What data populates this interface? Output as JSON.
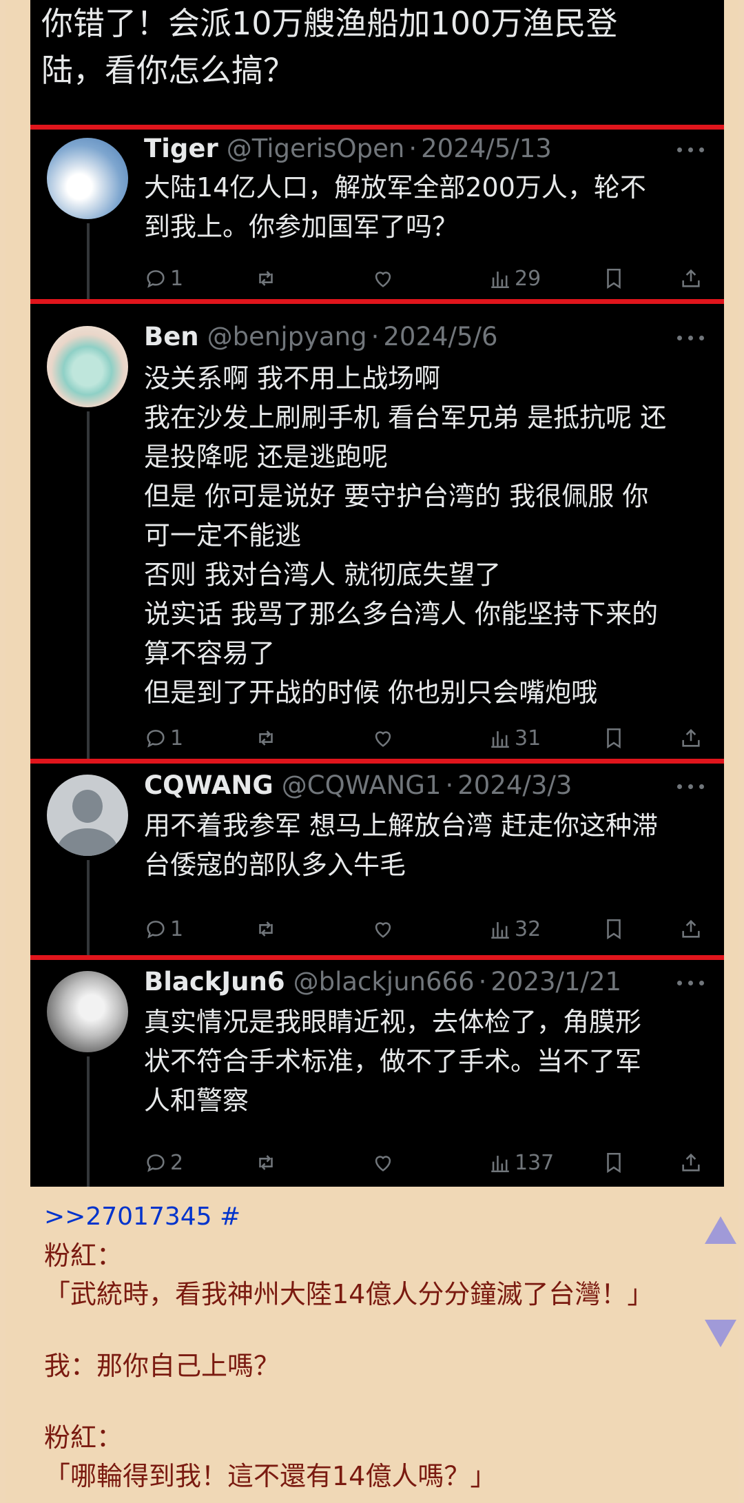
{
  "screenshot": {
    "top_text": [
      "你错了！会派10万艘渔船加100万渔民登",
      "陆，看你怎么搞？"
    ],
    "tweets": [
      {
        "name": "Tiger",
        "handle": "@TigerisOpen",
        "date": "2024/5/13",
        "lines": [
          "大陆14亿人口，解放军全部200万人，轮不",
          "到我上。你参加国军了吗？"
        ],
        "replies": "1",
        "views": "29"
      },
      {
        "name": "Ben",
        "handle": "@benjpyang",
        "date": "2024/5/6",
        "lines": [
          "没关系啊 我不用上战场啊",
          "我在沙发上刷刷手机 看台军兄弟 是抵抗呢 还",
          "是投降呢 还是逃跑呢",
          "但是 你可是说好 要守护台湾的 我很佩服 你",
          "可一定不能逃",
          "否则 我对台湾人 就彻底失望了",
          "说实话 我骂了那么多台湾人 你能坚持下来的",
          "算不容易了",
          "但是到了开战的时候 你也别只会嘴炮哦"
        ],
        "replies": "1",
        "views": "31"
      },
      {
        "name": "CQWANG",
        "handle": "@CQWANG1",
        "date": "2024/3/3",
        "lines": [
          "用不着我参军 想马上解放台湾 赶走你这种滞",
          "台倭寇的部队多入牛毛"
        ],
        "replies": "1",
        "views": "32"
      },
      {
        "name": "BlackJun6",
        "handle": "@blackjun666",
        "date": "2023/1/21",
        "lines": [
          "真实情况是我眼睛近视，去体检了，角膜形",
          "状不符合手术标准，做不了手术。当不了军",
          "人和警察"
        ],
        "replies": "2",
        "views": "137"
      }
    ]
  },
  "post": {
    "ref": ">>27017345 #",
    "lines": [
      "粉紅：",
      "「武統時，看我神州大陸14億人分分鐘滅了台灣！」",
      "我：那你自己上嗎？",
      "粉紅：",
      "「哪輪得到我！這不還有14億人嗎？」"
    ]
  },
  "icons": {
    "reply": "reply-icon",
    "retweet": "retweet-icon",
    "like": "heart-icon",
    "views": "views-icon",
    "bookmark": "bookmark-icon",
    "share": "share-icon",
    "more": "more-icon",
    "up": "arrow-up-icon",
    "down": "arrow-down-icon"
  },
  "colors": {
    "tweet_bg": "#000000",
    "divider": "#e0151c",
    "page_bg": "#f0d8b6",
    "post_text": "#7a1a10",
    "link": "#0033cc",
    "arrows": "#a09ad8"
  }
}
